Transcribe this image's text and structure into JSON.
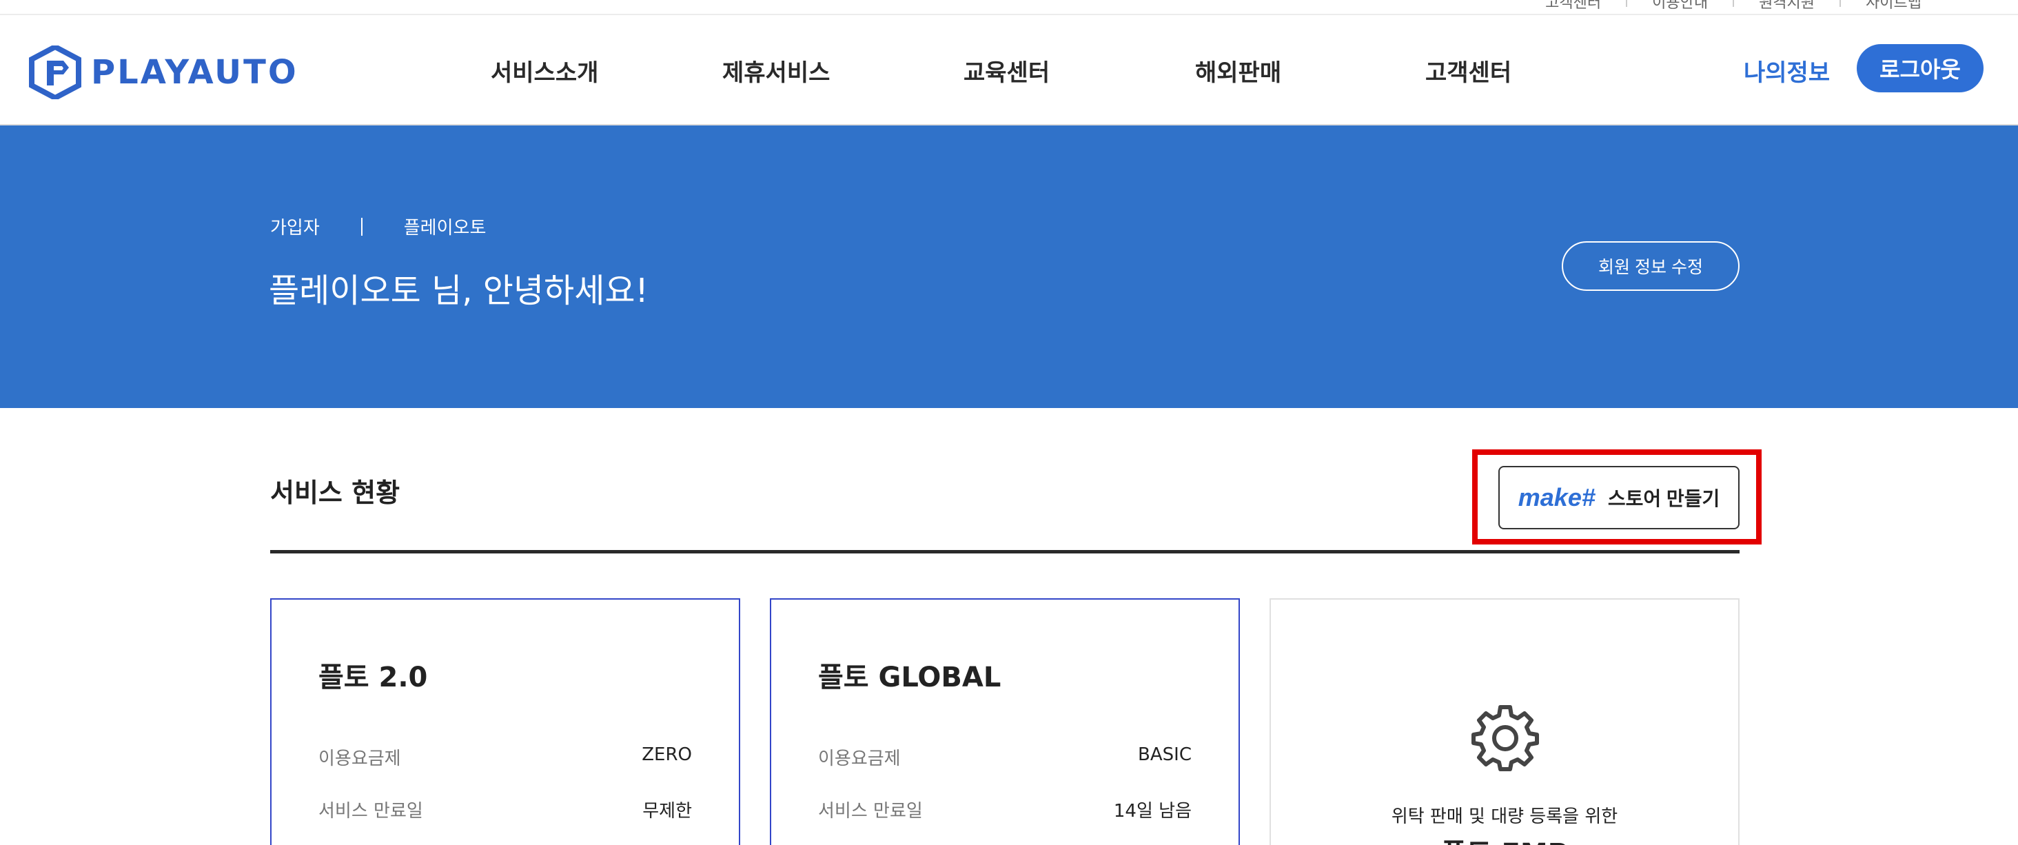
{
  "util_links": [
    "고객센터",
    "이용안내",
    "원격지원",
    "사이트맵"
  ],
  "logo": {
    "text": "PLAYAUTO"
  },
  "nav": {
    "items": [
      "서비스소개",
      "제휴서비스",
      "교육센터",
      "해외판매",
      "고객센터"
    ],
    "my_info": "나의정보",
    "logout": "로그아웃"
  },
  "banner": {
    "member_type": "가입자",
    "company": "플레이오토",
    "greeting": "플레이오토 님, 안녕하세요!",
    "edit_button": "회원 정보 수정"
  },
  "service": {
    "title": "서비스 현황",
    "make_logo": "make#",
    "make_button": "스토어 만들기"
  },
  "cards": [
    {
      "title": "플토 2.0",
      "plan_label": "이용요금제",
      "plan_value": "ZERO",
      "expiry_label": "서비스 만료일",
      "expiry_value": "무제한"
    },
    {
      "title": "플토 GLOBAL",
      "plan_label": "이용요금제",
      "plan_value": "BASIC",
      "expiry_label": "서비스 만료일",
      "expiry_value": "14일 남음"
    },
    {
      "icon": "gear-icon",
      "description": "위탁 판매 및 대량 등록을 위한",
      "title": "플토 EMP"
    }
  ],
  "colors": {
    "brand_blue": "#2e6fd6",
    "banner_blue": "#3072c9",
    "highlight_red": "#e20000",
    "card_border": "#3346c8"
  }
}
